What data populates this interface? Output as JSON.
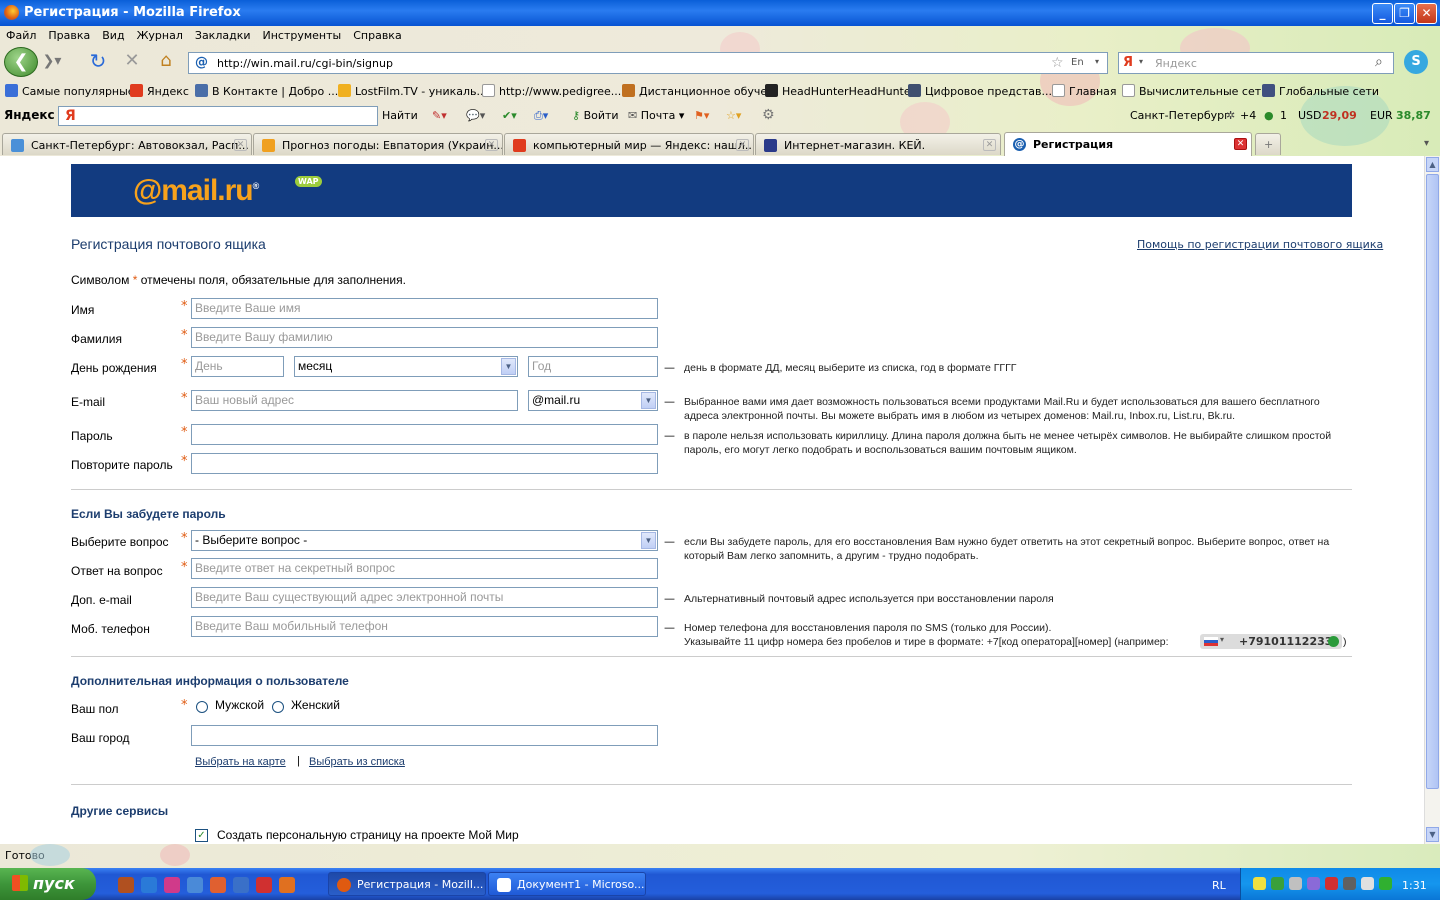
{
  "window": {
    "title": "Регистрация - Mozilla Firefox"
  },
  "menu": [
    "Файл",
    "Правка",
    "Вид",
    "Журнал",
    "Закладки",
    "Инструменты",
    "Справка"
  ],
  "nav": {
    "url": "http://win.mail.ru/cgi-bin/signup",
    "search_placeholder": "Яндекс",
    "search_lang": "En"
  },
  "bookmarks": [
    {
      "label": "Самые популярные",
      "color": "#3a6fd8"
    },
    {
      "label": "Яндекс",
      "color": "#e03b1e"
    },
    {
      "label": "В Контакте | Добро ...",
      "color": "#4a6ea8"
    },
    {
      "label": "LostFilm.TV - уникаль...",
      "color": "#f0b020"
    },
    {
      "label": "http://www.pedigree....",
      "color": "#ffffff"
    },
    {
      "label": "Дистанционное обуче...",
      "color": "#c07020"
    },
    {
      "label": "HeadHunterHeadHunter",
      "color": "#222222"
    },
    {
      "label": "Цифровое представ...",
      "color": "#405070"
    },
    {
      "label": "Главная",
      "color": "#ffffff"
    },
    {
      "label": "Вычислительные сет...",
      "color": "#ffffff"
    },
    {
      "label": "Глобальные сети",
      "color": "#405080"
    }
  ],
  "yabar": {
    "brand": "Яндекс",
    "find": "Найти",
    "login": "Войти",
    "mail": "Почта",
    "city": "Санкт-Петербург",
    "weather": "+4",
    "mail_count": "1",
    "usd_label": "USD",
    "usd_value": "29,09",
    "eur_label": "EUR",
    "eur_value": "38,87"
  },
  "tabs": [
    {
      "label": "Санкт-Петербург: Автовокзал, Расп...",
      "color": "#4a90d8"
    },
    {
      "label": "Прогноз погоды: Евпатория (Украин...",
      "color": "#f0a020"
    },
    {
      "label": "компьютерный мир — Яндекс: нашл...",
      "color": "#e03b1e"
    },
    {
      "label": "Интернет-магазин. КЕЙ.",
      "color": "#2a3a8a"
    },
    {
      "label": "Регистрация",
      "color": "#1a5fb0"
    }
  ],
  "page": {
    "logo_at": "@mail.ru",
    "logo_sup": "®",
    "wap": "WAP",
    "title": "Регистрация почтового ящика",
    "help_link": "Помощь по регистрации почтового ящика",
    "required_note_pre": "Символом",
    "required_note_post": "отмечены поля, обязательные для заполнения.",
    "star": "*",
    "fields": {
      "name_label": "Имя",
      "name_ph": "Введите Ваше имя",
      "surname_label": "Фамилия",
      "surname_ph": "Введите Вашу фамилию",
      "birthday_label": "День рождения",
      "day_ph": "День",
      "month_val": "месяц",
      "year_ph": "Год",
      "birthday_hint": "день в формате ДД, месяц выберите из списка, год в формате ГГГГ",
      "email_label": "E-mail",
      "email_ph": "Ваш новый адрес",
      "domain_val": "@mail.ru",
      "email_hint": "Выбранное вами имя дает возможность пользоваться всеми продуктами Mail.Ru и будет использоваться для вашего бесплатного адреса электронной почты. Вы можете выбрать имя в любом из четырех доменов: Mail.ru, Inbox.ru, List.ru, Bk.ru.",
      "password_label": "Пароль",
      "password_hint": "в пароле нельзя использовать кириллицу. Длина пароля должна быть не менее четырёх символов. Не выбирайте слишком простой пароль, его могут легко подобрать и воспользоваться вашим почтовым ящиком.",
      "password2_label": "Повторите пароль"
    },
    "recovery": {
      "title": "Если Вы забудете пароль",
      "question_label": "Выберите вопрос",
      "question_val": "- Выберите вопрос -",
      "question_hint": "если Вы забудете пароль, для его восстановления Вам нужно будет ответить на этот секретный вопрос. Выберите вопрос, ответ на который Вам легко запомнить, а другим - трудно подобрать.",
      "answer_label": "Ответ на вопрос",
      "answer_ph": "Введите ответ на секретный вопрос",
      "altemail_label": "Доп. e-mail",
      "altemail_ph": "Введите Ваш существующий адрес электронной почты",
      "altemail_hint": "Альтернативный почтовый адрес используется при восстановлении пароля",
      "phone_label": "Моб. телефон",
      "phone_ph": "Введите Ваш мобильный телефон",
      "phone_hint1": "Номер телефона для восстановления пароля по SMS (только для России).",
      "phone_hint2": "Указывайте 11 цифр номера без пробелов и тире в формате: +7[код оператора][номер] (например:",
      "phone_example": "+79101112233",
      "phone_close": ")"
    },
    "extra": {
      "title": "Дополнительная информация о пользователе",
      "gender_label": "Ваш пол",
      "male": "Мужской",
      "female": "Женский",
      "city_label": "Ваш город",
      "map_link": "Выбрать на карте",
      "sep": "|",
      "list_link": "Выбрать из списка"
    },
    "other": {
      "title": "Другие сервисы",
      "myworld": "Создать персональную страницу на проекте Мой Мир"
    }
  },
  "status": "Готово",
  "taskbar": {
    "start": "пуск",
    "tasks": [
      {
        "label": "Регистрация - Mozill...",
        "color": "#e05a10"
      },
      {
        "label": "Документ1 - Microso...",
        "color": "#2a5ec9"
      }
    ],
    "lang": "RL",
    "clock": "1:31"
  }
}
